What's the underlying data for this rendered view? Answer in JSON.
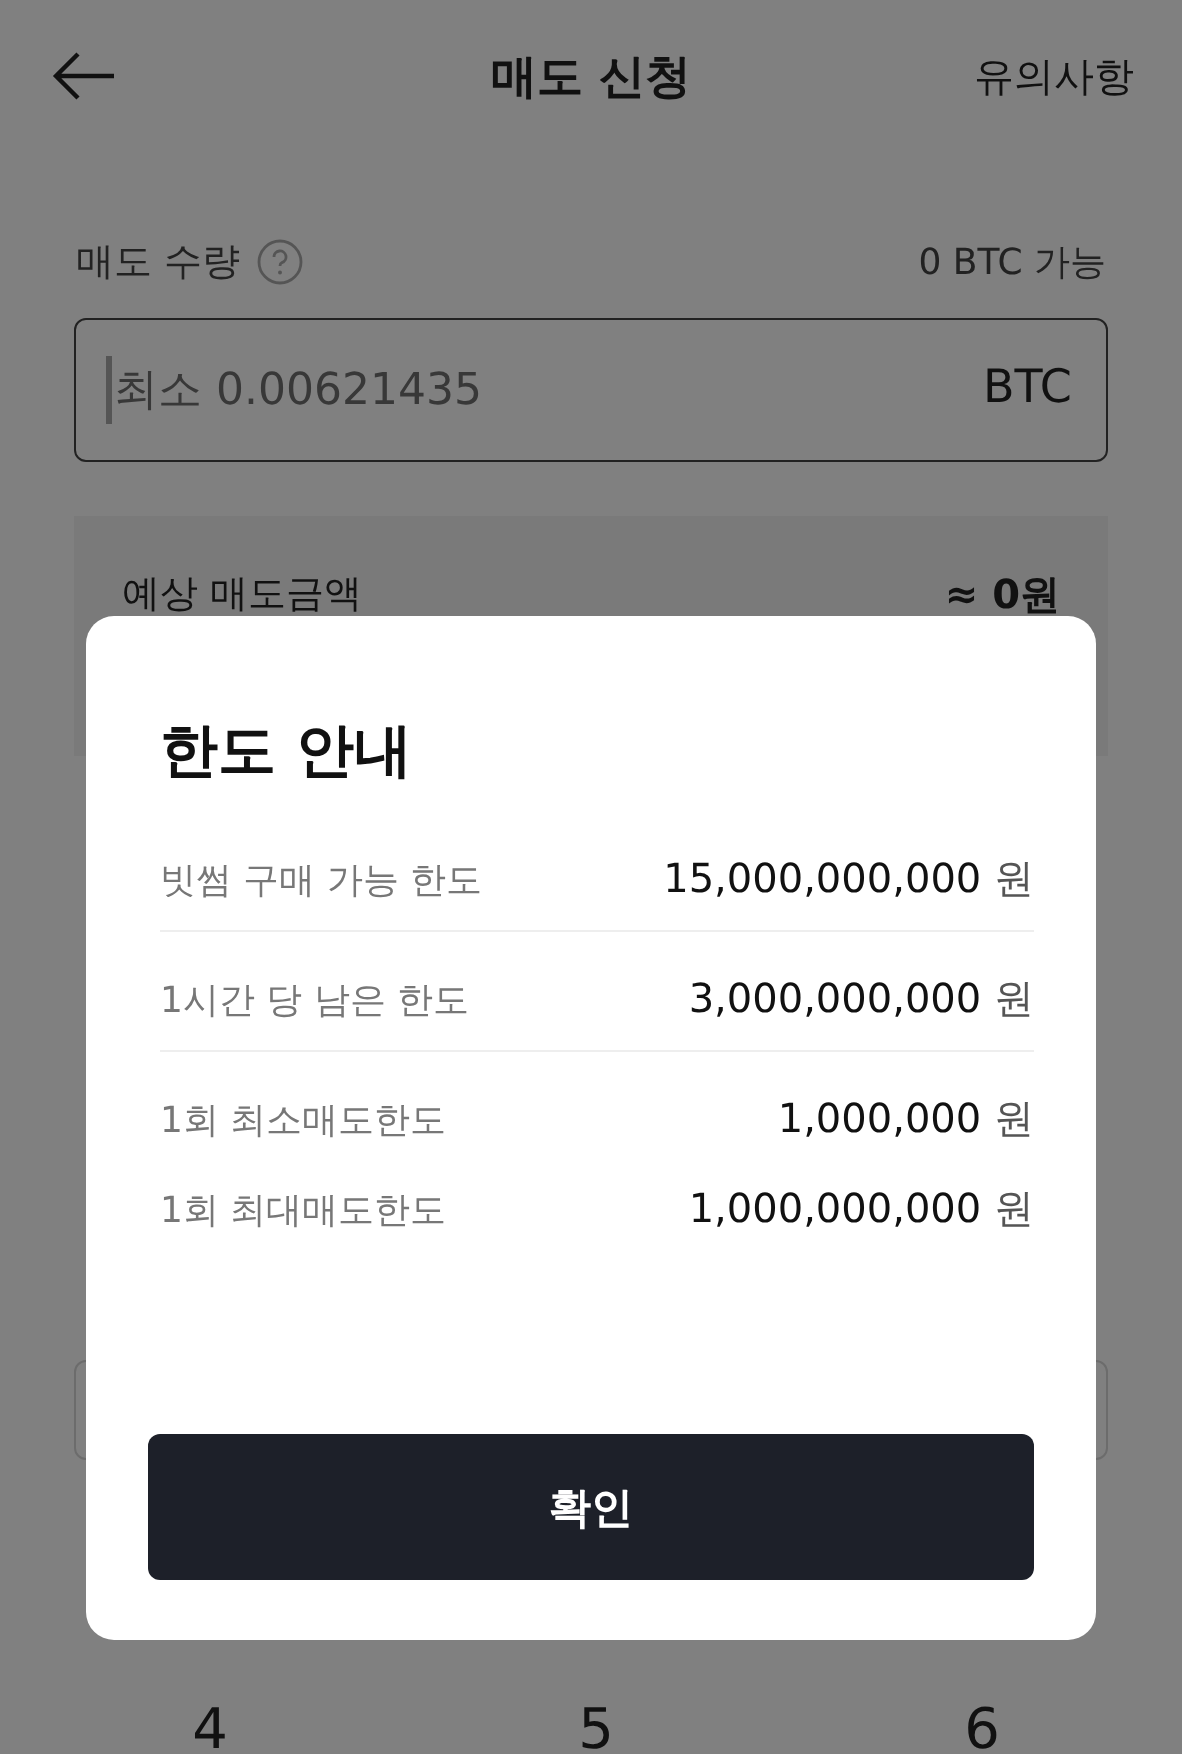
{
  "header": {
    "title": "매도 신청",
    "notice_link": "유의사항"
  },
  "quantity": {
    "label": "매도 수량",
    "available": "0 BTC 가능",
    "placeholder": "최소 0.00621435",
    "unit": "BTC"
  },
  "estimate": {
    "label": "예상 매도금액",
    "value": "≈ 0원"
  },
  "keypad": [
    "4",
    "5",
    "6"
  ],
  "modal": {
    "title": "한도 안내",
    "sections": [
      {
        "rows": [
          {
            "label": "빗썸 구매 가능 한도",
            "value": "15,000,000,000",
            "unit": "원"
          }
        ]
      },
      {
        "rows": [
          {
            "label": "1시간 당 남은 한도",
            "value": "3,000,000,000",
            "unit": "원"
          }
        ]
      },
      {
        "rows": [
          {
            "label": "1회 최소매도한도",
            "value": "1,000,000",
            "unit": "원"
          },
          {
            "label": "1회 최대매도한도",
            "value": "1,000,000,000",
            "unit": "원"
          }
        ]
      }
    ],
    "button": "확인"
  }
}
